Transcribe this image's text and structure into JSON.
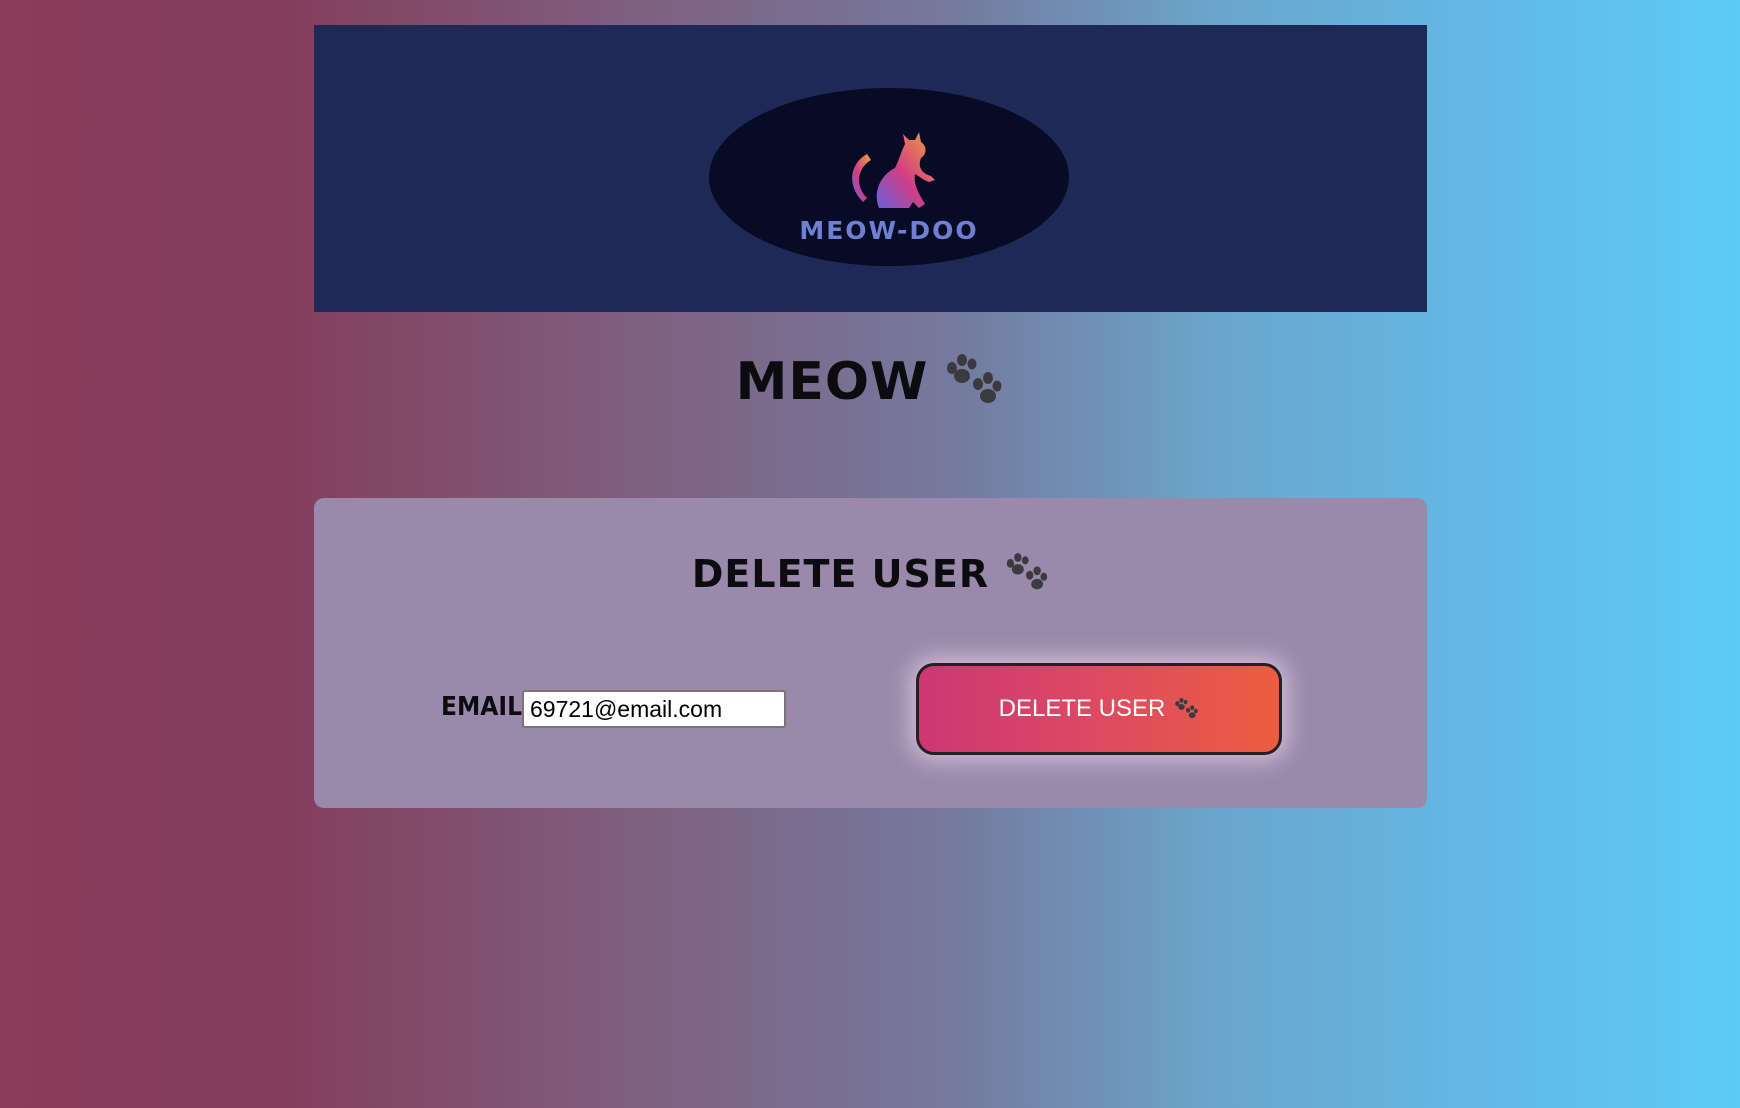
{
  "header": {
    "logo_text": "MEOW-DOO"
  },
  "page": {
    "title": "MEOW"
  },
  "card": {
    "title": "DELETE USER",
    "email_label": "EMAIL:",
    "email_value": "69721@email.com",
    "delete_button_label": "DELETE USER"
  },
  "colors": {
    "banner": "#1e2a55",
    "logo_oval": "#070b26",
    "logo_text": "#6f7fd3",
    "card_bg": "#9a89ab",
    "button_gradient_start": "#cc3773",
    "button_gradient_end": "#eb5e40"
  },
  "icons": {
    "title_icon": "paw-icon",
    "card_title_icon": "paw-icon",
    "button_icon": "paw-icon",
    "logo_icon": "cat-icon"
  }
}
